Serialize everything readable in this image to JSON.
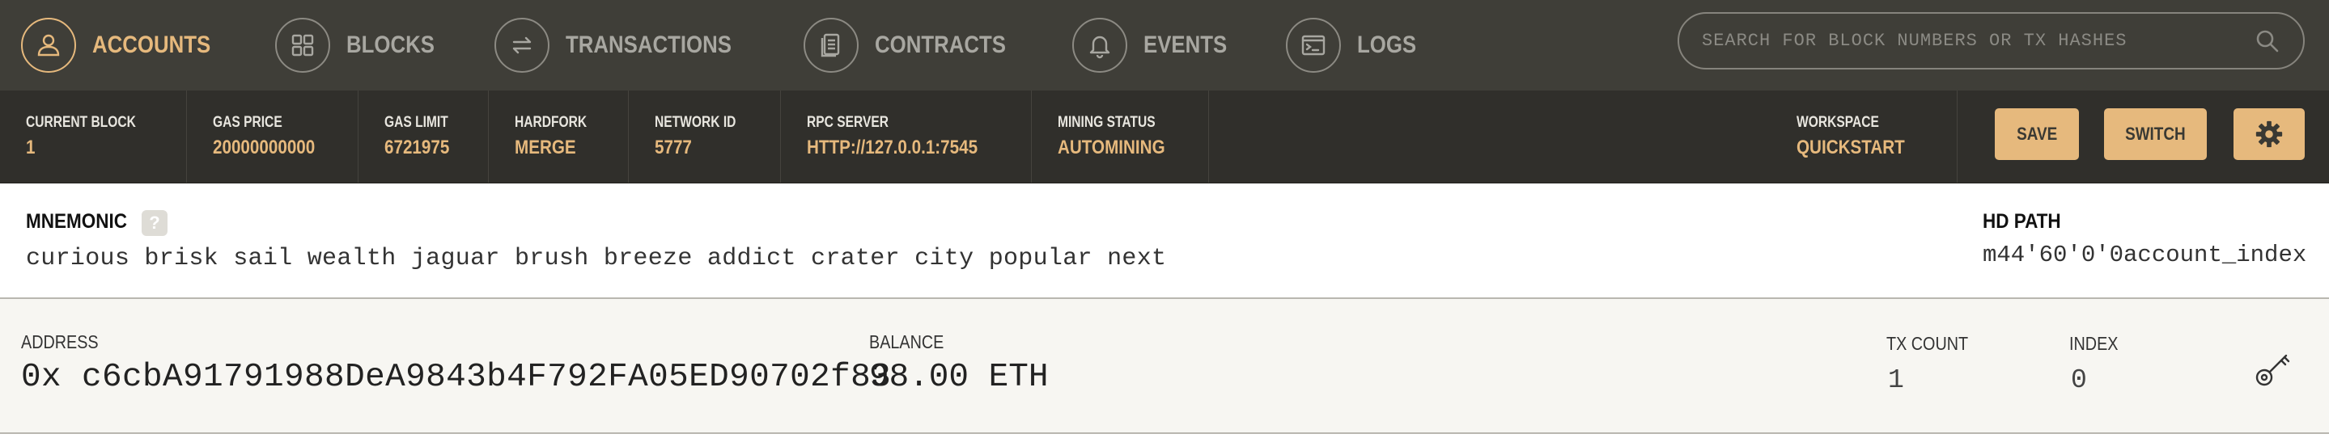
{
  "nav": {
    "items": [
      {
        "label": "ACCOUNTS",
        "icon": "person-icon",
        "active": true
      },
      {
        "label": "BLOCKS",
        "icon": "grid-icon",
        "active": false
      },
      {
        "label": "TRANSACTIONS",
        "icon": "arrows-icon",
        "active": false
      },
      {
        "label": "CONTRACTS",
        "icon": "document-icon",
        "active": false
      },
      {
        "label": "EVENTS",
        "icon": "bell-icon",
        "active": false
      },
      {
        "label": "LOGS",
        "icon": "terminal-icon",
        "active": false
      }
    ],
    "search_placeholder": "SEARCH FOR BLOCK NUMBERS OR TX HASHES"
  },
  "status": {
    "current_block": {
      "label": "CURRENT BLOCK",
      "value": "1"
    },
    "gas_price": {
      "label": "GAS PRICE",
      "value": "20000000000"
    },
    "gas_limit": {
      "label": "GAS LIMIT",
      "value": "6721975"
    },
    "hardfork": {
      "label": "HARDFORK",
      "value": "MERGE"
    },
    "network_id": {
      "label": "NETWORK ID",
      "value": "5777"
    },
    "rpc_server": {
      "label": "RPC SERVER",
      "value": "HTTP://127.0.0.1:7545"
    },
    "mining_status": {
      "label": "MINING STATUS",
      "value": "AUTOMINING"
    },
    "workspace": {
      "label": "WORKSPACE",
      "value": "QUICKSTART"
    },
    "save_label": "SAVE",
    "switch_label": "SWITCH"
  },
  "mnemonic": {
    "label": "MNEMONIC",
    "help": "?",
    "words": "curious brisk sail wealth jaguar brush breeze addict crater city popular next",
    "hd_path_label": "HD PATH",
    "hd_path_value": "m44'60'0'0account_index"
  },
  "account": {
    "address_label": "ADDRESS",
    "address": "0x c6cbA91791988DeA9843b4F792FA05ED90702f83",
    "balance_label": "BALANCE",
    "balance": "98.00 ETH",
    "tx_count_label": "TX COUNT",
    "tx_count": "1",
    "index_label": "INDEX",
    "index": "0"
  },
  "colors": {
    "nav_bg": "#3f3e38",
    "status_bg": "#302f2b",
    "accent": "#e6b97d",
    "row_bg": "#f7f6f2"
  }
}
